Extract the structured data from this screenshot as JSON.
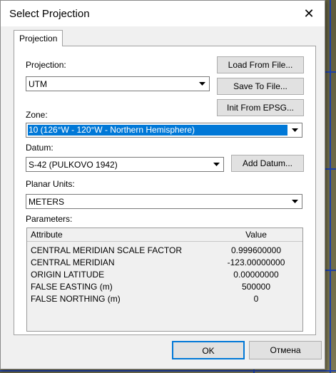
{
  "dialog": {
    "title": "Select Projection",
    "close_glyph": "✕",
    "tab_label": "Projection"
  },
  "projection": {
    "label": "Projection:",
    "value": "UTM"
  },
  "zone": {
    "label": "Zone:",
    "value": "10 (126°W - 120°W - Northern Hemisphere)"
  },
  "datum": {
    "label": "Datum:",
    "value": "S-42 (PULKOVO 1942)"
  },
  "units": {
    "label": "Planar Units:",
    "value": "METERS"
  },
  "buttons": {
    "load": "Load From File...",
    "save": "Save To File...",
    "epsg": "Init From EPSG...",
    "add_datum": "Add Datum...",
    "ok": "OK",
    "cancel": "Отмена"
  },
  "parameters": {
    "label": "Parameters:",
    "col_attribute": "Attribute",
    "col_value": "Value",
    "rows": [
      {
        "attribute": "CENTRAL MERIDIAN SCALE FACTOR",
        "value": "0.999600000"
      },
      {
        "attribute": "CENTRAL MERIDIAN",
        "value": "-123.00000000"
      },
      {
        "attribute": "ORIGIN LATITUDE",
        "value": "0.00000000"
      },
      {
        "attribute": "FALSE EASTING (m)",
        "value": "500000"
      },
      {
        "attribute": "FALSE NORTHING (m)",
        "value": "0"
      }
    ]
  },
  "colors": {
    "selection": "#0078d7",
    "map_lines": "#1c3fa8"
  },
  "icons": [
    "close-icon",
    "dropdown-arrow-icon"
  ]
}
